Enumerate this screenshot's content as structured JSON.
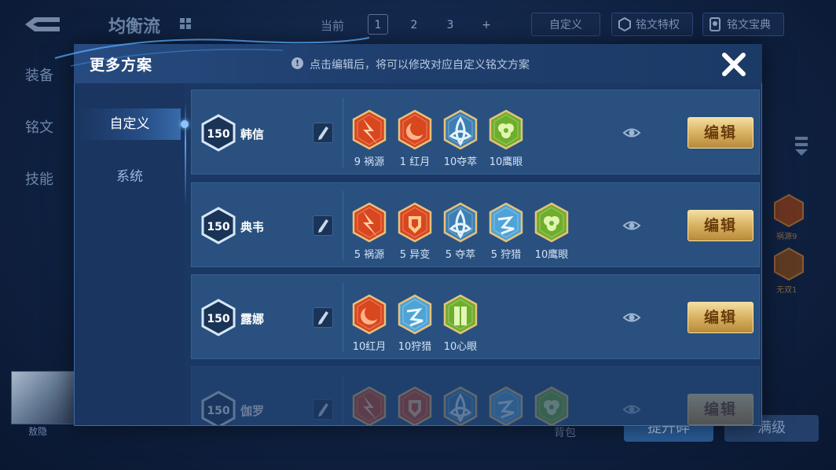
{
  "background": {
    "title": "均衡流",
    "current_label": "当前",
    "pages": [
      "1",
      "2",
      "3",
      "+"
    ],
    "custom_btn": "自定义",
    "privilege_btn": "铭文特权",
    "codex_btn": "铭文宝典",
    "sidebar": [
      "装备",
      "铭文",
      "技能"
    ],
    "rune_side": [
      "祸源9",
      "无双1"
    ],
    "avatar_label": "敖隐",
    "bag_label": "背包",
    "upgrade_btn": "提升碎",
    "max_btn": "满级"
  },
  "modal": {
    "title": "更多方案",
    "hint": "点击编辑后，将可以修改对应自定义铭文方案",
    "tabs": [
      "自定义",
      "系统"
    ],
    "edit_label": "编辑",
    "plans": [
      {
        "level": "150",
        "hero": "韩信",
        "runes": [
          {
            "label": "9 祸源",
            "type": "red-strike"
          },
          {
            "label": "1 红月",
            "type": "red-moon"
          },
          {
            "label": "10夺萃",
            "type": "blue-knot"
          },
          {
            "label": "10鹰眼",
            "type": "green-clover"
          }
        ]
      },
      {
        "level": "150",
        "hero": "典韦",
        "runes": [
          {
            "label": "5 祸源",
            "type": "red-strike"
          },
          {
            "label": "5 异变",
            "type": "red-shield"
          },
          {
            "label": "5 夺萃",
            "type": "blue-knot"
          },
          {
            "label": "5 狩猎",
            "type": "blue-bolt"
          },
          {
            "label": "10鹰眼",
            "type": "green-clover"
          }
        ]
      },
      {
        "level": "150",
        "hero": "露娜",
        "runes": [
          {
            "label": "10红月",
            "type": "red-moon"
          },
          {
            "label": "10狩猎",
            "type": "blue-bolt"
          },
          {
            "label": "10心眼",
            "type": "green-book"
          }
        ]
      },
      {
        "level": "150",
        "hero": "伽罗",
        "runes": [
          {
            "label": "",
            "type": "red-strike"
          },
          {
            "label": "",
            "type": "red-shield"
          },
          {
            "label": "",
            "type": "blue-knot"
          },
          {
            "label": "",
            "type": "blue-bolt"
          },
          {
            "label": "",
            "type": "green-clover"
          }
        ]
      }
    ]
  },
  "colors": {
    "red": "#d9471f",
    "blue": "#4fa3d6",
    "green": "#6fae2c",
    "gold": "#d8b161"
  }
}
